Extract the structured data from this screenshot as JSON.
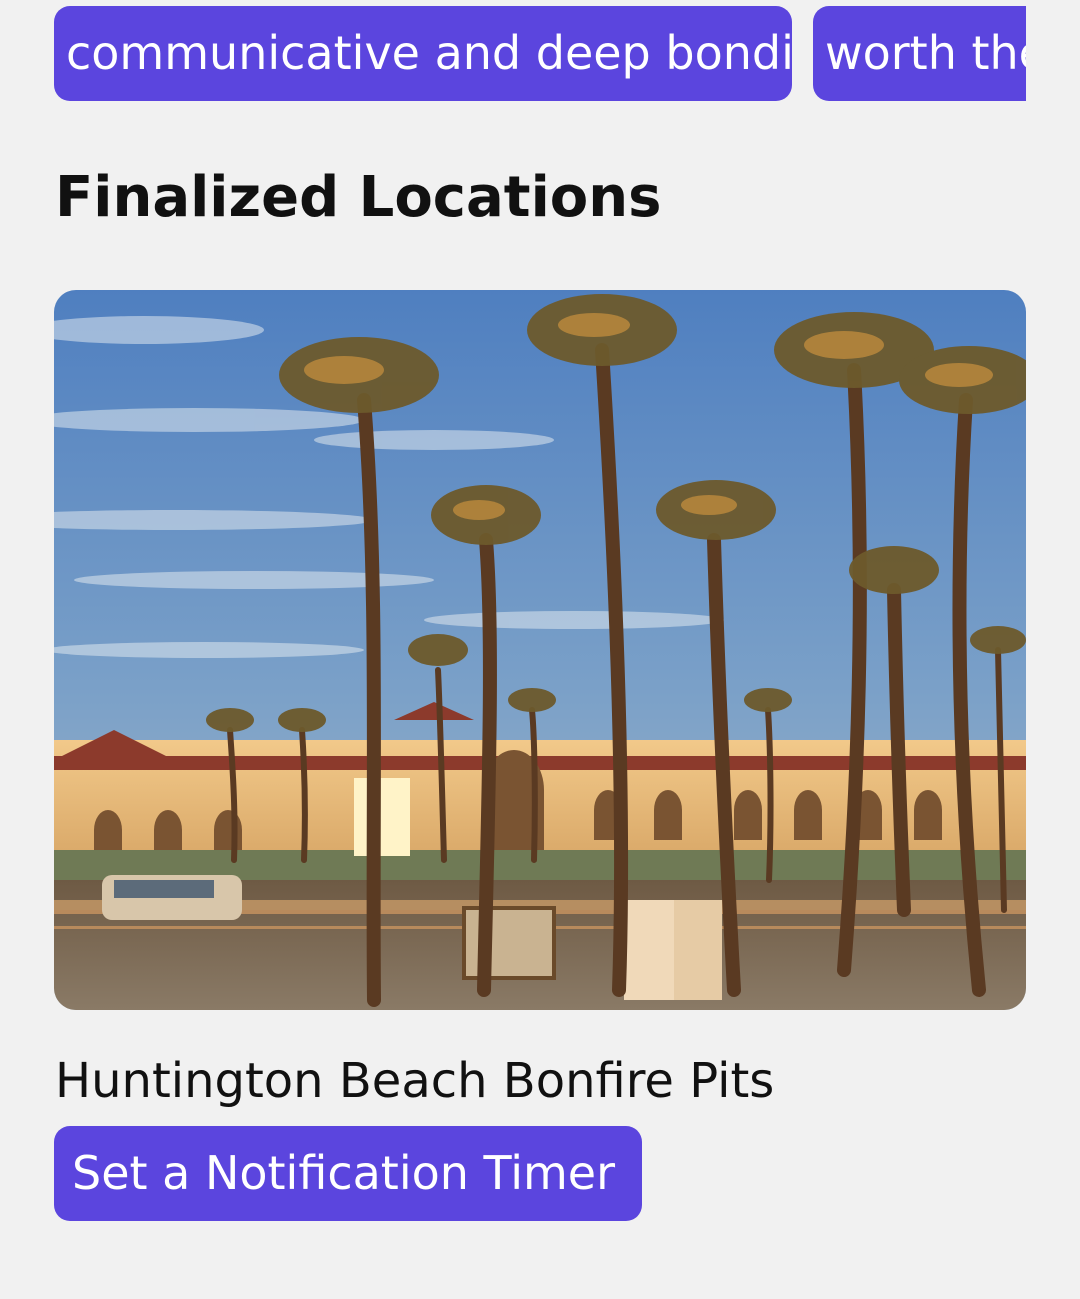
{
  "tags": [
    {
      "label": "communicative and deep bonding"
    },
    {
      "label": "worth the"
    }
  ],
  "section": {
    "title": "Finalized Locations"
  },
  "carousel": {
    "slide_count": 6,
    "active_index": 0
  },
  "location": {
    "name": "Huntington Beach Bonfire Pits"
  },
  "actions": {
    "notify_label": "Set a Notification Timer"
  },
  "colors": {
    "accent": "#5b45de",
    "background": "#f1f1f1"
  }
}
